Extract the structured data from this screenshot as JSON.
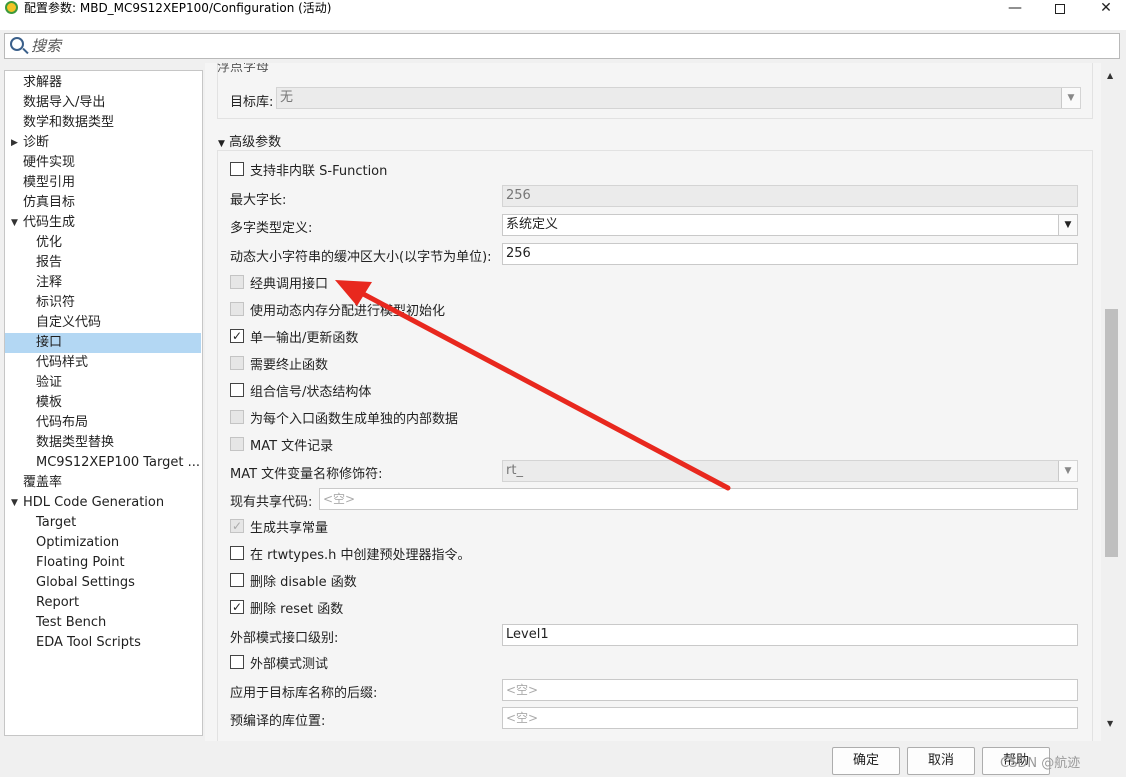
{
  "window": {
    "title": "配置参数: MBD_MC9S12XEP100/Configuration (活动)",
    "minimize_glyph": "—",
    "close_glyph": "✕"
  },
  "search": {
    "placeholder": "搜索"
  },
  "tree": {
    "items": [
      {
        "label": "求解器"
      },
      {
        "label": "数据导入/导出"
      },
      {
        "label": "数学和数据类型"
      },
      {
        "label": "诊断",
        "arrow": "▶"
      },
      {
        "label": "硬件实现"
      },
      {
        "label": "模型引用"
      },
      {
        "label": "仿真目标"
      },
      {
        "label": "代码生成",
        "arrow": "▼"
      },
      {
        "label": "优化"
      },
      {
        "label": "报告"
      },
      {
        "label": "注释"
      },
      {
        "label": "标识符"
      },
      {
        "label": "自定义代码"
      },
      {
        "label": "接口",
        "selected": true
      },
      {
        "label": "代码样式"
      },
      {
        "label": "验证"
      },
      {
        "label": "模板"
      },
      {
        "label": "代码布局"
      },
      {
        "label": "数据类型替换"
      },
      {
        "label": "MC9S12XEP100 Target ..."
      },
      {
        "label": "覆盖率"
      },
      {
        "label": "HDL Code Generation",
        "arrow": "▼"
      },
      {
        "label": "Target"
      },
      {
        "label": "Optimization"
      },
      {
        "label": "Floating Point"
      },
      {
        "label": "Global Settings"
      },
      {
        "label": "Report"
      },
      {
        "label": "Test Bench"
      },
      {
        "label": "EDA Tool Scripts"
      }
    ]
  },
  "main": {
    "cut_section_heading": "浮点字母",
    "target_library_label": "目标库:",
    "target_library_value": "无",
    "advanced_heading": "高级参数",
    "advanced_arrow": "▼",
    "rows": {
      "support_noninlined_sfunction": {
        "label": "支持非内联 S-Function",
        "checked": false,
        "disabled": false
      },
      "max_word_length_label": "最大字长:",
      "max_word_length_value": "256",
      "multiword_type_label": "多字类型定义:",
      "multiword_type_value": "系统定义",
      "dynamic_string_buffer_label": "动态大小字符串的缓冲区大小(以字节为单位):",
      "dynamic_string_buffer_value": "256",
      "classic_call_interface": {
        "label": "经典调用接口",
        "checked": false,
        "disabled": true
      },
      "dynamic_memory_init": {
        "label": "使用动态内存分配进行模型初始化",
        "checked": false,
        "disabled": true
      },
      "single_output_update": {
        "label": "单一输出/更新函数",
        "checked": true,
        "disabled": false
      },
      "terminate_function": {
        "label": "需要终止函数",
        "checked": false,
        "disabled": true
      },
      "combine_signal_state": {
        "label": "组合信号/状态结构体",
        "checked": false,
        "disabled": false
      },
      "separate_internal_data": {
        "label": "为每个入口函数生成单独的内部数据",
        "checked": false,
        "disabled": true
      },
      "mat_file_logging": {
        "label": "MAT 文件记录",
        "checked": false,
        "disabled": true
      },
      "mat_file_var_modifier_label": "MAT 文件变量名称修饰符:",
      "mat_file_var_modifier_value": "rt_",
      "existing_shared_code_label": "现有共享代码:",
      "existing_shared_code_placeholder": "<空>",
      "generate_shared_constants": {
        "label": "生成共享常量",
        "checked": true,
        "disabled": true
      },
      "rtwtypes_preprocessor": {
        "label": "在 rtwtypes.h 中创建预处理器指令。",
        "checked": false,
        "disabled": false
      },
      "remove_disable_function": {
        "label": "删除 disable 函数",
        "checked": false,
        "disabled": false
      },
      "remove_reset_function": {
        "label": "删除 reset 函数",
        "checked": true,
        "disabled": false
      },
      "ext_mode_interface_level_label": "外部模式接口级别:",
      "ext_mode_interface_level_value": "Level1",
      "ext_mode_testing": {
        "label": "外部模式测试",
        "checked": false,
        "disabled": false
      },
      "target_lib_name_suffix_label": "应用于目标库名称的后缀:",
      "target_lib_name_suffix_placeholder": "<空>",
      "precompiled_lib_location_label": "预编译的库位置:",
      "precompiled_lib_location_placeholder": "<空>"
    }
  },
  "footer": {
    "ok_label": "确定",
    "cancel_label": "取消",
    "help_label": "帮助",
    "watermark": "CSDN @航迹"
  },
  "colors": {
    "selection": "#b3d7f3",
    "annotation_arrow": "#e8281e"
  },
  "icons": {
    "check_glyph": "✓",
    "dropdown_glyph": "▼",
    "scroll_up_glyph": "▲",
    "scroll_down_glyph": "▼"
  }
}
